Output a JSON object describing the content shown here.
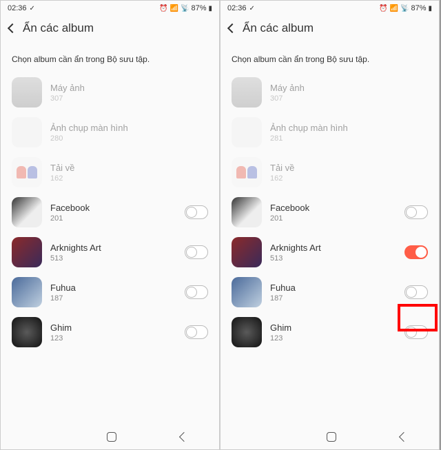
{
  "status": {
    "time": "02:36",
    "battery": "87%"
  },
  "page": {
    "title": "Ẩn các album",
    "subtitle": "Chọn album cần ẩn trong Bộ sưu tập."
  },
  "left": {
    "albums": [
      {
        "name": "Máy ảnh",
        "count": "307",
        "dim": true,
        "toggle": null
      },
      {
        "name": "Ảnh chụp màn hình",
        "count": "280",
        "dim": true,
        "toggle": null
      },
      {
        "name": "Tải về",
        "count": "162",
        "dim": true,
        "toggle": null
      },
      {
        "name": "Facebook",
        "count": "201",
        "dim": false,
        "toggle": "off"
      },
      {
        "name": "Arknights Art",
        "count": "513",
        "dim": false,
        "toggle": "off"
      },
      {
        "name": "Fuhua",
        "count": "187",
        "dim": false,
        "toggle": "off"
      },
      {
        "name": "Ghim",
        "count": "123",
        "dim": false,
        "toggle": "off"
      }
    ]
  },
  "right": {
    "albums": [
      {
        "name": "Máy ảnh",
        "count": "307",
        "dim": true,
        "toggle": null
      },
      {
        "name": "Ảnh chụp màn hình",
        "count": "281",
        "dim": true,
        "toggle": null
      },
      {
        "name": "Tải về",
        "count": "162",
        "dim": true,
        "toggle": null
      },
      {
        "name": "Facebook",
        "count": "201",
        "dim": false,
        "toggle": "off"
      },
      {
        "name": "Arknights Art",
        "count": "513",
        "dim": false,
        "toggle": "on"
      },
      {
        "name": "Fuhua",
        "count": "187",
        "dim": false,
        "toggle": "off"
      },
      {
        "name": "Ghim",
        "count": "123",
        "dim": false,
        "toggle": "off"
      }
    ]
  }
}
